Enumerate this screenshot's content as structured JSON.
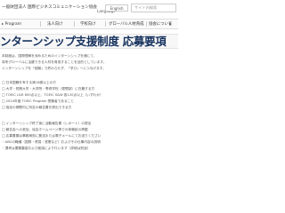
{
  "header": {
    "org_name": "一般財団法人 国際ビジネスコミュニケーション協会",
    "language_label": "Language",
    "english_button": "English",
    "search_placeholder": "サイト内検索"
  },
  "nav": {
    "items": [
      {
        "label": "Program"
      },
      {
        "label": "法人向け"
      },
      {
        "label": "学校向け"
      },
      {
        "label": "グローバル人材育成"
      },
      {
        "label": "協会について"
      }
    ]
  },
  "page": {
    "title": "ンターンシップ支援制度 応募要項",
    "paragraphs": [
      "本制度は、国際理解を深めるためのインターンシップを通じて、",
      "将来グローバルに活躍できる人材を育成することを目的としています。",
      "インターンシップを「経験」で終わらせず、「学び」へとつなげます。",
      "",
      "□ 日本国籍を有する満18歳以上の方",
      "□ 大学・短期大学・大学院・専修学校（昼間部）に在籍する方",
      "□ TOEIC L&R 600点以上、TOEIC S&W 各120点以上（いずれか）",
      "□ 2024年度 TOEIC Program 受験者であること",
      "□ 指定の期間内に所定の報告書を提出できる方",
      "",
      "□ インターンシップ終了後に活動報告書（レポート）の提出",
      "□ 報告会への参加、協会ホームページ等での体験談の掲載",
      "□ 応募書類は事務局宛に郵送または電子メールにてお送りください",
      "・ABCの職種（国際・貿易・営業など）およびその仕事内容の説明",
      "・選考は書類審査および面接により行います（詳細は別途）"
    ]
  }
}
